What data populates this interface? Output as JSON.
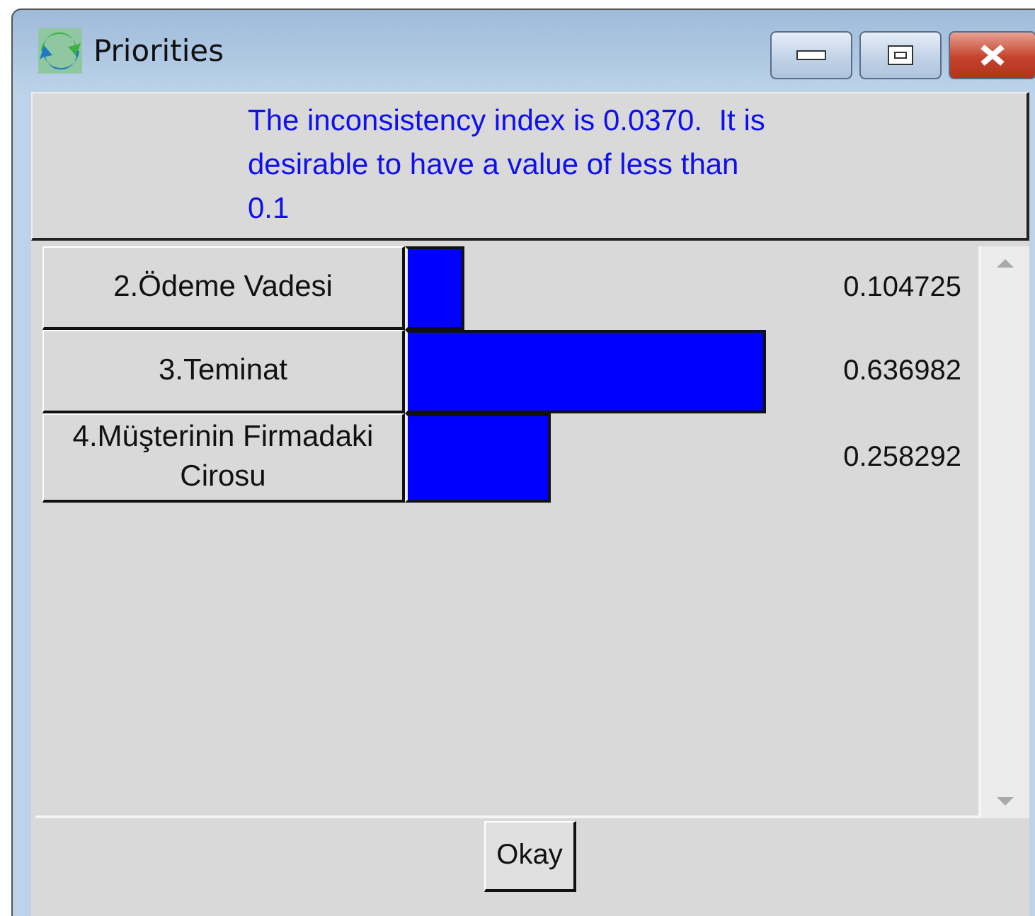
{
  "window": {
    "title": "Priorities"
  },
  "message": "The inconsistency index is 0.0370.  It is desirable to have a value of less than 0.1",
  "priorities": [
    {
      "label": "2.Ödeme Vadesi",
      "value": "0.104725"
    },
    {
      "label": "3.Teminat",
      "value": "0.636982"
    },
    {
      "label": "4.Müşterinin Firmadaki Cirosu",
      "value": "0.258292"
    }
  ],
  "buttons": [
    "Okay"
  ]
}
